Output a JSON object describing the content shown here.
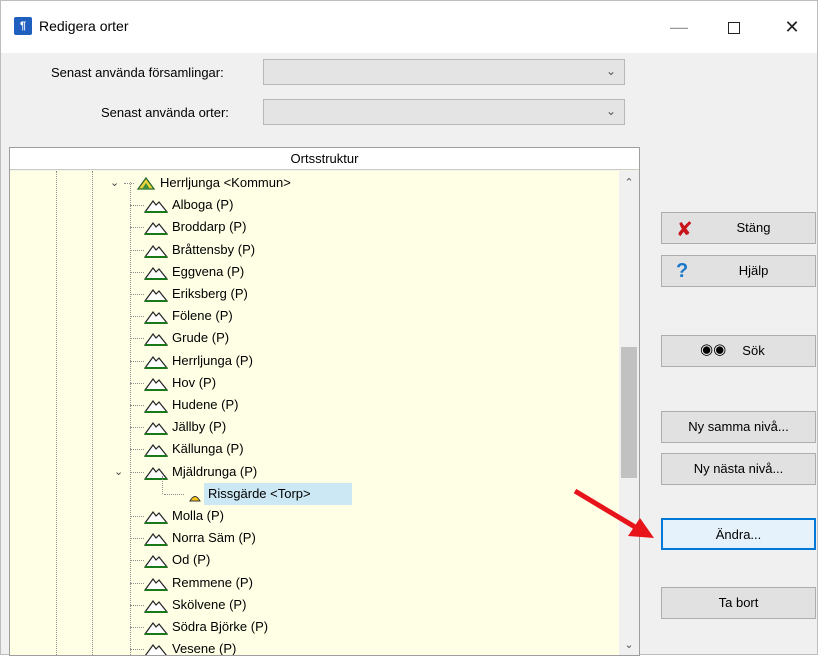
{
  "window": {
    "title": "Redigera orter",
    "app_icon_text": "¶"
  },
  "form": {
    "recent_parishes_label": "Senast använda församlingar:",
    "recent_parishes_value": "",
    "recent_places_label": "Senast använda orter:",
    "recent_places_value": ""
  },
  "tree": {
    "header": "Ortsstruktur",
    "root": {
      "label": "Herrljunga <Kommun>",
      "expanded": true
    },
    "items": [
      {
        "label": "Alboga (P)"
      },
      {
        "label": "Broddarp (P)"
      },
      {
        "label": "Bråttensby (P)"
      },
      {
        "label": "Eggvena (P)"
      },
      {
        "label": "Eriksberg (P)"
      },
      {
        "label": "Fölene (P)"
      },
      {
        "label": "Grude (P)"
      },
      {
        "label": "Herrljunga (P)"
      },
      {
        "label": "Hov (P)"
      },
      {
        "label": "Hudene (P)"
      },
      {
        "label": "Jällby (P)"
      },
      {
        "label": "Källunga (P)"
      },
      {
        "label": "Mjäldrunga (P)",
        "expanded": true
      },
      {
        "label": "Rissgärde <Torp>",
        "selected": true,
        "child": true
      },
      {
        "label": "Molla (P)"
      },
      {
        "label": "Norra Säm (P)"
      },
      {
        "label": "Od (P)"
      },
      {
        "label": "Remmene (P)"
      },
      {
        "label": "Skölvene (P)"
      },
      {
        "label": "Södra Björke (P)"
      },
      {
        "label": "Vesene (P)"
      }
    ]
  },
  "buttons": {
    "close": "Stäng",
    "help": "Hjälp",
    "search": "Sök",
    "new_same_level": "Ny samma nivå...",
    "new_next_level": "Ny nästa nivå...",
    "edit": "Ändra...",
    "delete": "Ta bort"
  },
  "colors": {
    "tree_background": "#ffffe6",
    "selection": "#cce8f4",
    "accent": "#0078d7",
    "annotation_arrow": "#e8141b"
  }
}
